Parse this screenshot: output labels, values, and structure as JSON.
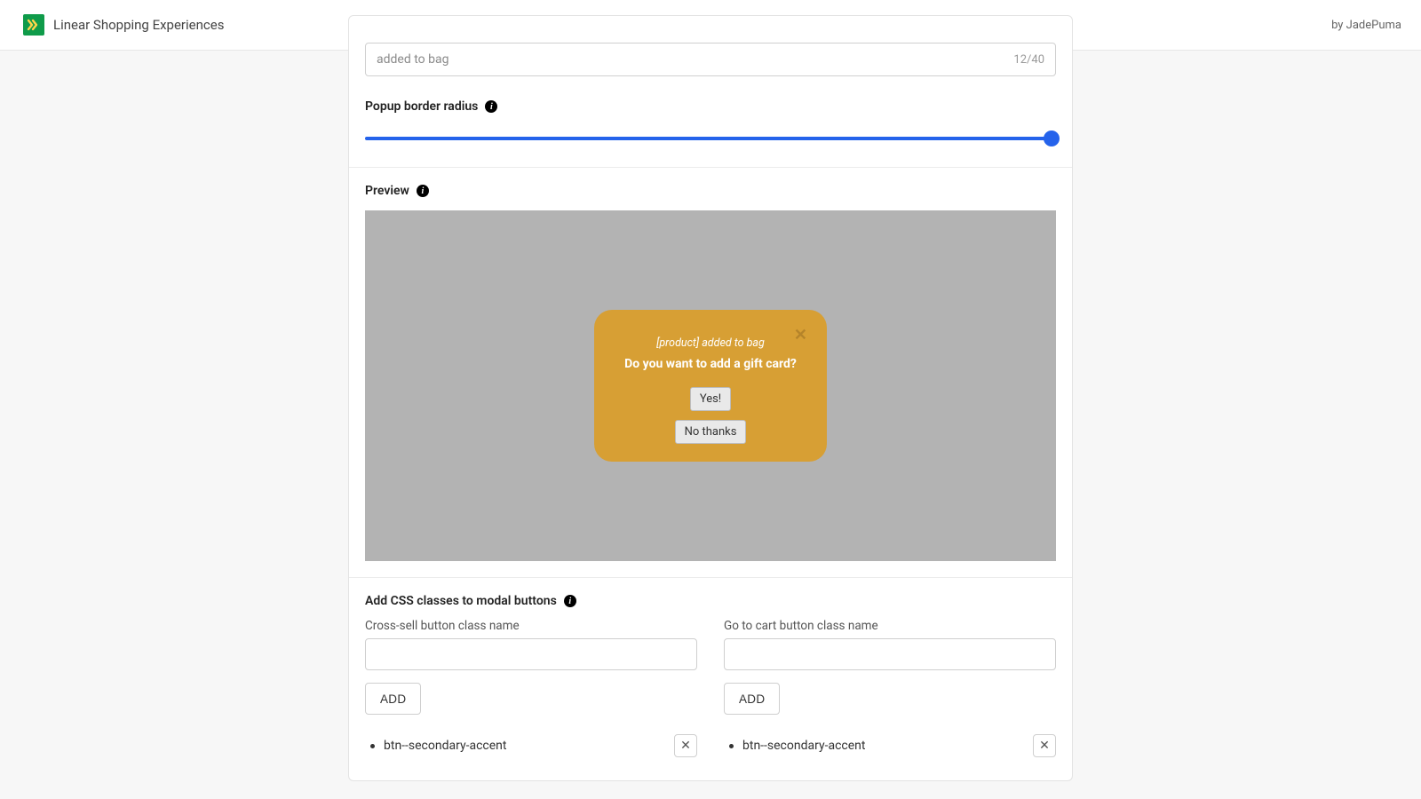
{
  "header": {
    "app_title": "Linear Shopping Experiences",
    "byline": "by JadePuma"
  },
  "scrolled_field": {
    "value": "added to bag",
    "count": "12/40"
  },
  "radius": {
    "label": "Popup border radius"
  },
  "preview": {
    "label": "Preview",
    "popup": {
      "line1": "[product] added to bag",
      "line2": "Do you want to add a gift card?",
      "yes": "Yes!",
      "no": "No thanks"
    }
  },
  "css_section": {
    "title": "Add CSS classes to modal buttons",
    "left": {
      "label": "Cross-sell button class name",
      "add": "ADD",
      "item": "btn--secondary-accent"
    },
    "right": {
      "label": "Go to cart button class name",
      "add": "ADD",
      "item": "btn--secondary-accent"
    }
  }
}
